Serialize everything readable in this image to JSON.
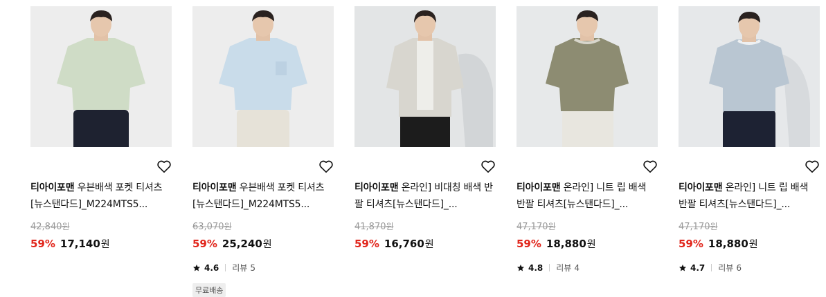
{
  "currency_unit": "원",
  "review_label": "리뷰",
  "products": [
    {
      "brand": "티아이포맨",
      "name": "우븐배색 포켓 티셔츠[뉴스탠다드]_M224MTS5...",
      "original_price": "42,840",
      "discount": "59%",
      "price": "17,140",
      "bg_color": "#ededed",
      "shirt_color": "#cfdcc6",
      "pants_color": "#1e2230"
    },
    {
      "brand": "티아이포맨",
      "name": "우븐배색 포켓 티셔츠[뉴스탠다드]_M224MTS5...",
      "original_price": "63,070",
      "discount": "59%",
      "price": "25,240",
      "rating": "4.6",
      "review_count": "5",
      "badge": "무료배송",
      "bg_color": "#ededed",
      "shirt_color": "#c9dcea",
      "pants_color": "#e6e2d8"
    },
    {
      "brand": "티아이포맨",
      "name": "온라인] 비대칭 배색 반팔 티셔츠[뉴스탠다드]_...",
      "original_price": "41,870",
      "discount": "59%",
      "price": "16,760",
      "bg_color": "#e3e5e6",
      "shirt_color": "#d8d6cf",
      "pants_color": "#1c1c1c"
    },
    {
      "brand": "티아이포맨",
      "name": "온라인] 니트 립 배색 반팔 티셔츠[뉴스탠다드]_...",
      "original_price": "47,170",
      "discount": "59%",
      "price": "18,880",
      "rating": "4.8",
      "review_count": "4",
      "bg_color": "#e7e9ea",
      "shirt_color": "#8d8c72",
      "pants_color": "#e8e6df"
    },
    {
      "brand": "티아이포맨",
      "name": "온라인] 니트 립 배색 반팔 티셔츠[뉴스탠다드]_...",
      "original_price": "47,170",
      "discount": "59%",
      "price": "18,880",
      "rating": "4.7",
      "review_count": "6",
      "bg_color": "#e6e8ea",
      "shirt_color": "#b9c6d2",
      "pants_color": "#1d2233"
    }
  ]
}
